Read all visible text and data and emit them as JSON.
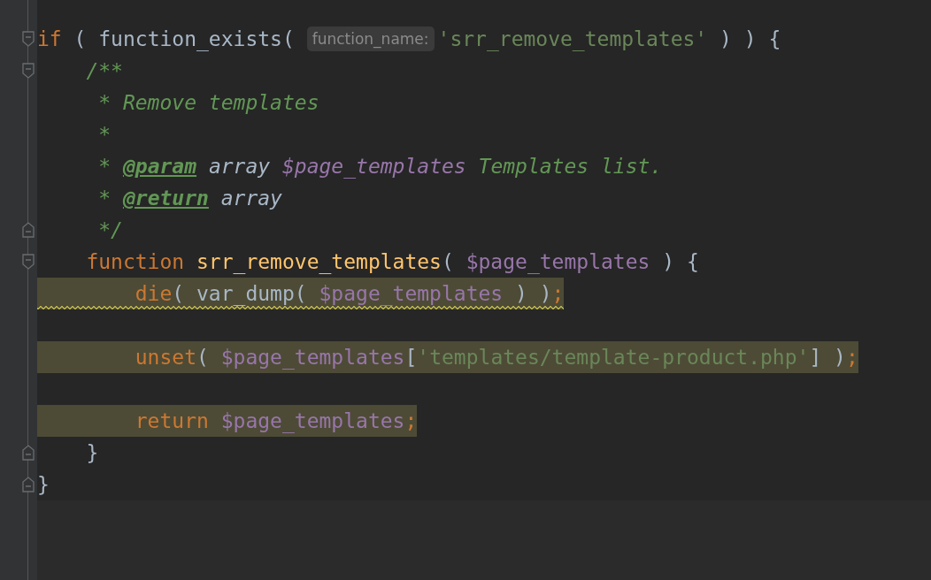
{
  "editor": {
    "lines": [
      {
        "fold_start": true,
        "fold_end": false,
        "highlighted": false,
        "warning": false,
        "tokens": [
          {
            "kind": "keyword",
            "text": "if"
          },
          {
            "kind": "plain",
            "text": " ( function_exists( "
          },
          {
            "kind": "hint",
            "text": "function_name:"
          },
          {
            "kind": "string",
            "text": "'srr_remove_templates'"
          },
          {
            "kind": "plain",
            "text": " ) ) {"
          }
        ]
      },
      {
        "fold_start": true,
        "fold_end": false,
        "highlighted": false,
        "warning": false,
        "tokens": [
          {
            "kind": "comment",
            "text": "    /**"
          }
        ]
      },
      {
        "fold_start": false,
        "fold_end": false,
        "highlighted": false,
        "warning": false,
        "tokens": [
          {
            "kind": "comment",
            "text": "     * Remove templates"
          }
        ]
      },
      {
        "fold_start": false,
        "fold_end": false,
        "highlighted": false,
        "warning": false,
        "tokens": [
          {
            "kind": "comment",
            "text": "     *"
          }
        ]
      },
      {
        "fold_start": false,
        "fold_end": false,
        "highlighted": false,
        "warning": false,
        "tokens": [
          {
            "kind": "comment",
            "text": "     * "
          },
          {
            "kind": "doc_tag",
            "text": "@param"
          },
          {
            "kind": "doc_type",
            "text": " array "
          },
          {
            "kind": "doc_var",
            "text": "$page_templates"
          },
          {
            "kind": "comment",
            "text": " Templates list."
          }
        ]
      },
      {
        "fold_start": false,
        "fold_end": false,
        "highlighted": false,
        "warning": false,
        "tokens": [
          {
            "kind": "comment",
            "text": "     * "
          },
          {
            "kind": "doc_tag",
            "text": "@return"
          },
          {
            "kind": "doc_type",
            "text": " array"
          }
        ]
      },
      {
        "fold_start": false,
        "fold_end": true,
        "highlighted": false,
        "warning": false,
        "tokens": [
          {
            "kind": "comment",
            "text": "     */"
          }
        ]
      },
      {
        "fold_start": true,
        "fold_end": false,
        "highlighted": false,
        "warning": false,
        "tokens": [
          {
            "kind": "keyword",
            "text": "    function"
          },
          {
            "kind": "function",
            "text": " srr_remove_templates"
          },
          {
            "kind": "plain",
            "text": "( "
          },
          {
            "kind": "variable",
            "text": "$page_templates"
          },
          {
            "kind": "plain",
            "text": " ) {"
          }
        ]
      },
      {
        "fold_start": false,
        "fold_end": false,
        "highlighted": true,
        "warning": true,
        "tokens": [
          {
            "kind": "keyword",
            "text": "        die"
          },
          {
            "kind": "plain",
            "text": "( var_dump( "
          },
          {
            "kind": "variable",
            "text": "$page_templates"
          },
          {
            "kind": "plain",
            "text": " ) )"
          },
          {
            "kind": "keyword",
            "text": ";"
          }
        ]
      },
      {
        "fold_start": false,
        "fold_end": false,
        "highlighted": false,
        "warning": false
      },
      {
        "fold_start": false,
        "fold_end": false,
        "highlighted": true,
        "warning": false,
        "tokens": [
          {
            "kind": "keyword",
            "text": "        unset"
          },
          {
            "kind": "plain",
            "text": "( "
          },
          {
            "kind": "variable",
            "text": "$page_templates"
          },
          {
            "kind": "plain",
            "text": "["
          },
          {
            "kind": "string",
            "text": "'templates/template-product.php'"
          },
          {
            "kind": "plain",
            "text": "] )"
          },
          {
            "kind": "keyword",
            "text": ";"
          }
        ]
      },
      {
        "fold_start": false,
        "fold_end": false,
        "highlighted": false,
        "warning": false
      },
      {
        "fold_start": false,
        "fold_end": false,
        "highlighted": true,
        "warning": false,
        "tokens": [
          {
            "kind": "keyword",
            "text": "        return"
          },
          {
            "kind": "variable",
            "text": " $page_templates"
          },
          {
            "kind": "keyword",
            "text": ";"
          }
        ]
      },
      {
        "fold_start": false,
        "fold_end": true,
        "highlighted": false,
        "warning": false,
        "tokens": [
          {
            "kind": "plain",
            "text": "    }"
          }
        ]
      },
      {
        "fold_start": false,
        "fold_end": true,
        "highlighted": false,
        "warning": false,
        "tokens": [
          {
            "kind": "plain",
            "text": "}"
          }
        ]
      }
    ]
  }
}
